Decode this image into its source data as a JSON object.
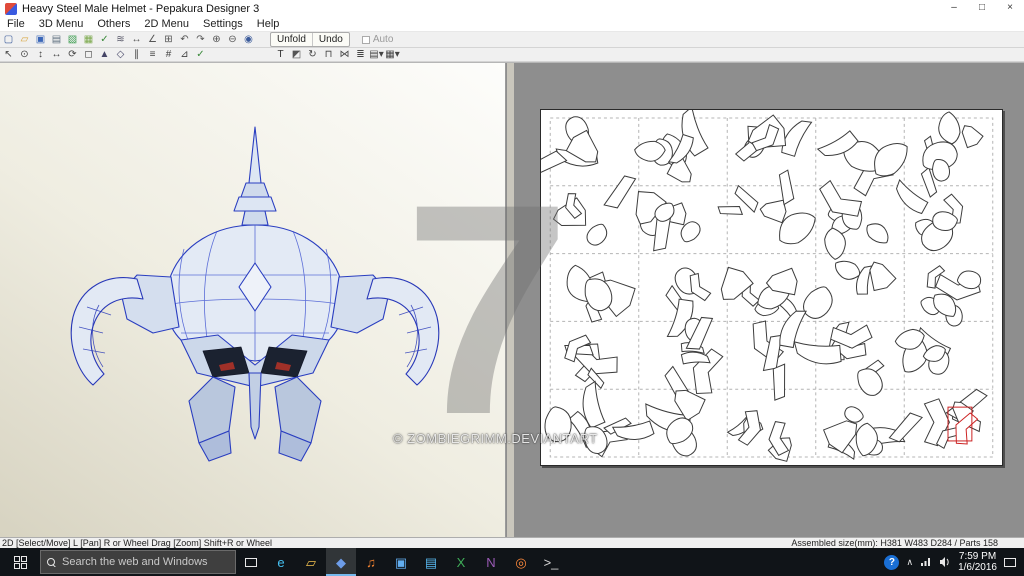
{
  "window": {
    "title": "Heavy Steel Male Helmet - Pepakura Designer 3",
    "controls": {
      "minimize": "–",
      "maximize": "□",
      "close": "×"
    }
  },
  "menu": {
    "items": [
      "File",
      "3D Menu",
      "Others",
      "2D Menu",
      "Settings",
      "Help"
    ]
  },
  "toolbar_main": {
    "icons": [
      {
        "name": "new-file-icon",
        "glyph": "▢",
        "color": "#3a5a9a"
      },
      {
        "name": "open-file-icon",
        "glyph": "▱",
        "color": "#d8a33a"
      },
      {
        "name": "save-icon",
        "glyph": "▣",
        "color": "#3a66b8"
      },
      {
        "name": "print-icon",
        "glyph": "▤",
        "color": "#607080"
      },
      {
        "name": "texture-view-icon",
        "glyph": "▧",
        "color": "#3a9c4e"
      },
      {
        "name": "material-view-icon",
        "glyph": "▦",
        "color": "#7aa84a"
      },
      {
        "name": "unfold-check-icon",
        "glyph": "✓",
        "color": "#3a8a3a"
      },
      {
        "name": "pattern-icon",
        "glyph": "≋",
        "color": "#556"
      },
      {
        "name": "measure-icon",
        "glyph": "↔",
        "color": "#555"
      },
      {
        "name": "angle-icon",
        "glyph": "∠",
        "color": "#555"
      },
      {
        "name": "grid-icon",
        "glyph": "⊞",
        "color": "#555"
      },
      {
        "name": "rotate-left-icon",
        "glyph": "↶",
        "color": "#555"
      },
      {
        "name": "rotate-right-icon",
        "glyph": "↷",
        "color": "#555"
      },
      {
        "name": "zoom-in-icon",
        "glyph": "⊕",
        "color": "#555"
      },
      {
        "name": "zoom-out-icon",
        "glyph": "⊖",
        "color": "#555"
      },
      {
        "name": "info-icon",
        "glyph": "◉",
        "color": "#3a5a9a"
      }
    ],
    "unfold_label": "Unfold",
    "undo_label": "Undo",
    "auto_label": "Auto"
  },
  "toolbar_2d": {
    "group_a": [
      {
        "name": "select-tool-icon",
        "glyph": "↖",
        "color": "#444"
      },
      {
        "name": "magnify-tool-icon",
        "glyph": "⊙",
        "color": "#444"
      },
      {
        "name": "pan-vertical-tool-icon",
        "glyph": "↕",
        "color": "#444"
      },
      {
        "name": "pan-horizontal-tool-icon",
        "glyph": "↔",
        "color": "#444"
      },
      {
        "name": "orbit-tool-icon",
        "glyph": "⟳",
        "color": "#444"
      },
      {
        "name": "box-select-tool-icon",
        "glyph": "◻",
        "color": "#444"
      },
      {
        "name": "face-select-tool-icon",
        "glyph": "▲",
        "color": "#446"
      },
      {
        "name": "edge-select-tool-icon",
        "glyph": "◇",
        "color": "#446"
      },
      {
        "name": "line-tool-icon",
        "glyph": "∥",
        "color": "#444"
      },
      {
        "name": "list-tool-icon",
        "glyph": "≡",
        "color": "#444"
      },
      {
        "name": "mesh-tool-icon",
        "glyph": "#",
        "color": "#444"
      },
      {
        "name": "triangle-tool-icon",
        "glyph": "⊿",
        "color": "#444"
      },
      {
        "name": "check-tool-icon",
        "glyph": "✓",
        "color": "#3a8a3a"
      }
    ],
    "group_b": [
      {
        "name": "text-tool-icon",
        "glyph": "T",
        "color": "#333"
      },
      {
        "name": "color-tool-icon",
        "glyph": "◩",
        "color": "#555"
      },
      {
        "name": "rotate-part-tool-icon",
        "glyph": "↻",
        "color": "#444"
      },
      {
        "name": "flap-tool-icon",
        "glyph": "⊓",
        "color": "#444"
      },
      {
        "name": "join-tool-icon",
        "glyph": "⋈",
        "color": "#444"
      },
      {
        "name": "order-tool-icon",
        "glyph": "≣",
        "color": "#444"
      },
      {
        "name": "layout-menu-icon",
        "glyph": "▤▾",
        "color": "#444"
      },
      {
        "name": "export-menu-icon",
        "glyph": "▦▾",
        "color": "#444"
      }
    ]
  },
  "pattern_page": {
    "rows": 5,
    "cols": 5,
    "selected_part_color": "#cc2222"
  },
  "watermark": {
    "big_glyph": "7",
    "text": "© ZOMBIEGRIMM.DEVIANTART"
  },
  "status_bar": {
    "left": "2D [Select/Move] L [Pan] R or Wheel Drag [Zoom] Shift+R or Wheel",
    "right": "Assembled size(mm): H381 W483 D284 / Parts 158"
  },
  "taskbar": {
    "search_placeholder": "Search the web and Windows",
    "apps": [
      {
        "name": "edge",
        "glyph": "e",
        "color": "#45c0f0"
      },
      {
        "name": "file-explorer",
        "glyph": "▱",
        "color": "#f2c14e"
      },
      {
        "name": "pepakura",
        "glyph": "◆",
        "color": "#6d9ce8",
        "active": true
      },
      {
        "name": "groove-music",
        "glyph": "♫",
        "color": "#f08030"
      },
      {
        "name": "photos",
        "glyph": "▣",
        "color": "#62aef0"
      },
      {
        "name": "store",
        "glyph": "▤",
        "color": "#58b8ee"
      },
      {
        "name": "excel",
        "glyph": "X",
        "color": "#3fae59"
      },
      {
        "name": "onenote",
        "glyph": "N",
        "color": "#9a5bb5"
      },
      {
        "name": "firefox",
        "glyph": "◎",
        "color": "#ff8a3c"
      },
      {
        "name": "cmd",
        "glyph": ">_",
        "color": "#d8d8d8"
      }
    ],
    "clock": {
      "time": "7:59 PM",
      "date": "1/6/2016"
    }
  }
}
